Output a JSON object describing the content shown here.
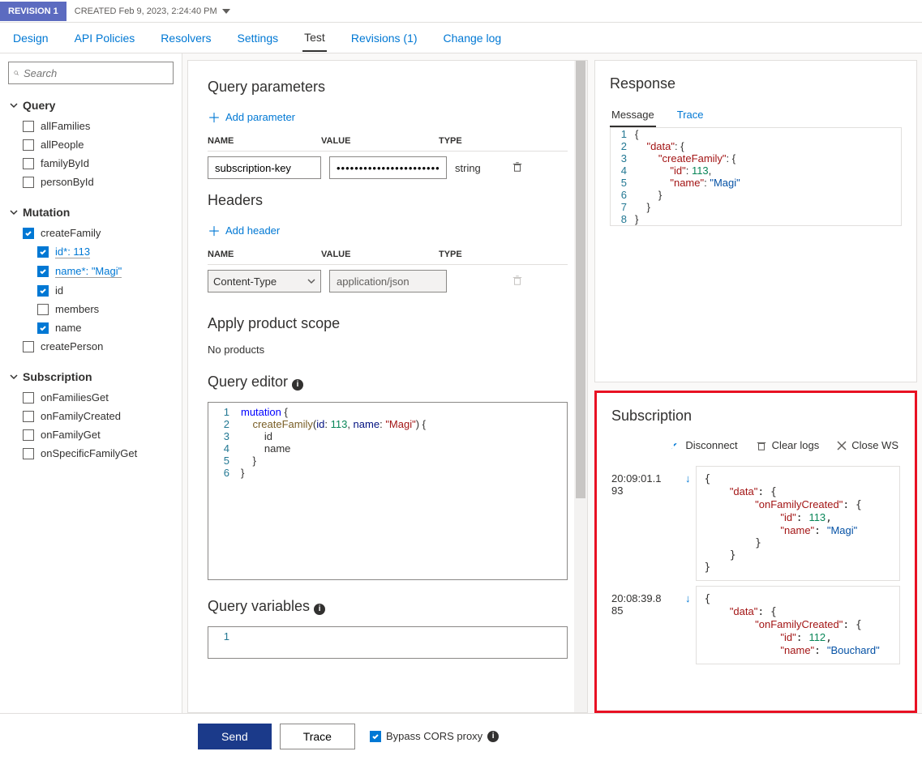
{
  "revision": {
    "badge": "REVISION 1",
    "created": "CREATED Feb 9, 2023, 2:24:40 PM"
  },
  "tabs": [
    "Design",
    "API Policies",
    "Resolvers",
    "Settings",
    "Test",
    "Revisions (1)",
    "Change log"
  ],
  "active_tab": "Test",
  "search_placeholder": "Search",
  "sidebar": {
    "query": {
      "title": "Query",
      "items": [
        "allFamilies",
        "allPeople",
        "familyById",
        "personById"
      ]
    },
    "mutation": {
      "title": "Mutation",
      "createFamily": {
        "label": "createFamily",
        "args": [
          {
            "name": "id*",
            "value": "113"
          },
          {
            "name": "name*",
            "value": "\"Magi\""
          }
        ],
        "fields": [
          {
            "label": "id",
            "checked": true
          },
          {
            "label": "members",
            "checked": false
          },
          {
            "label": "name",
            "checked": true
          }
        ]
      },
      "createPerson": {
        "label": "createPerson"
      }
    },
    "subscription": {
      "title": "Subscription",
      "items": [
        "onFamiliesGet",
        "onFamilyCreated",
        "onFamilyGet",
        "onSpecificFamilyGet"
      ]
    }
  },
  "query_params": {
    "title": "Query parameters",
    "add": "Add parameter",
    "cols": {
      "name": "NAME",
      "value": "VALUE",
      "type": "TYPE"
    },
    "row": {
      "name": "subscription-key",
      "value": "••••••••••••••••••••••••",
      "type": "string"
    }
  },
  "headers": {
    "title": "Headers",
    "add": "Add header",
    "row": {
      "name": "Content-Type",
      "value": "application/json"
    }
  },
  "scope": {
    "title": "Apply product scope",
    "none": "No products"
  },
  "editor": {
    "title": "Query editor",
    "lines": [
      "mutation {",
      "    createFamily(id: 113, name: \"Magi\") {",
      "        id",
      "        name",
      "    }",
      "}"
    ]
  },
  "variables_title": "Query variables",
  "response": {
    "title": "Response",
    "tabs": [
      "Message",
      "Trace"
    ],
    "json_lines": [
      "{",
      "    \"data\": {",
      "        \"createFamily\": {",
      "            \"id\": 113,",
      "            \"name\": \"Magi\"",
      "        }",
      "    }",
      "}"
    ]
  },
  "subscription_panel": {
    "title": "Subscription",
    "actions": {
      "disconnect": "Disconnect",
      "clear": "Clear logs",
      "close": "Close WS"
    },
    "logs": [
      {
        "time": "20:09:01.193",
        "body": [
          "{",
          "    \"data\": {",
          "        \"onFamilyCreated\": {",
          "            \"id\": 113,",
          "            \"name\": \"Magi\"",
          "        }",
          "    }",
          "}"
        ]
      },
      {
        "time": "20:08:39.885",
        "body": [
          "{",
          "    \"data\": {",
          "        \"onFamilyCreated\": {",
          "            \"id\": 112,",
          "            \"name\": \"Bouchard\""
        ]
      }
    ]
  },
  "footer": {
    "send": "Send",
    "trace": "Trace",
    "bypass": "Bypass CORS proxy"
  },
  "chart_data": {
    "type": "table",
    "title": "GraphQL test console state",
    "request": {
      "operation": "mutation",
      "field": "createFamily",
      "arguments": {
        "id": 113,
        "name": "Magi"
      },
      "selection": [
        "id",
        "name"
      ]
    },
    "response": {
      "data": {
        "createFamily": {
          "id": 113,
          "name": "Magi"
        }
      }
    },
    "subscription_events": [
      {
        "timestamp": "20:09:01.193",
        "data": {
          "onFamilyCreated": {
            "id": 113,
            "name": "Magi"
          }
        }
      },
      {
        "timestamp": "20:08:39.885",
        "data": {
          "onFamilyCreated": {
            "id": 112,
            "name": "Bouchard"
          }
        }
      }
    ]
  }
}
